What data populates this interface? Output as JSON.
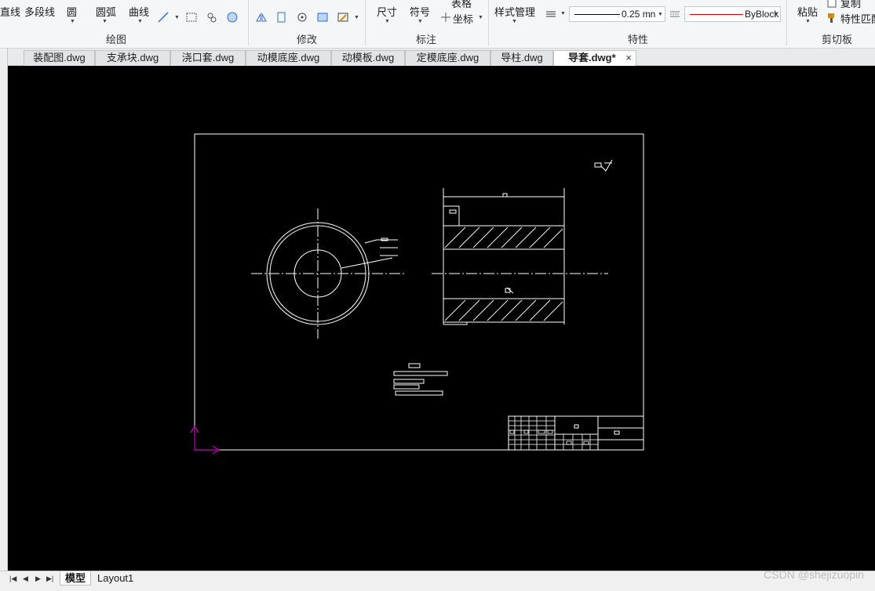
{
  "ribbon": {
    "draw": {
      "line": "直线",
      "polyline": "多段线",
      "circle": "圆",
      "arc": "圆弧",
      "curve": "曲线",
      "group_label": "绘图"
    },
    "modify": {
      "group_label": "修改"
    },
    "annotate": {
      "dimension": "尺寸",
      "symbol": "符号",
      "table": "表格",
      "coordinate": "坐标",
      "group_label": "标注"
    },
    "properties": {
      "style_manager": "样式管理",
      "lineweight": "0.25 mn",
      "color": "ByBlock",
      "group_label": "特性"
    },
    "clipboard": {
      "paste": "粘贴",
      "copy": "复制",
      "match_props": "特性匹配",
      "group_label": "剪切板"
    }
  },
  "tabs": [
    {
      "label": "装配图.dwg"
    },
    {
      "label": "支承块.dwg"
    },
    {
      "label": "浇口套.dwg"
    },
    {
      "label": "动模底座.dwg"
    },
    {
      "label": "动模板.dwg"
    },
    {
      "label": "定模底座.dwg"
    },
    {
      "label": "导柱.dwg"
    },
    {
      "label": "导套.dwg*",
      "active": true
    }
  ],
  "tab_close": "×",
  "layouts": {
    "model": "模型",
    "layout1": "Layout1"
  },
  "nav_icons": [
    "first-icon",
    "prev-icon",
    "next-icon",
    "last-icon"
  ],
  "watermark": "CSDN @shejizuopin",
  "colors": {
    "canvas": "#000000",
    "linework": "#ffffff",
    "ucs": "#c000c0",
    "ribbon": "#f5f6f7"
  }
}
